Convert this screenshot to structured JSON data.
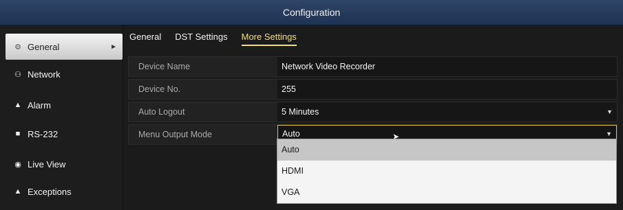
{
  "window": {
    "title": "Configuration"
  },
  "sidebar": {
    "items": [
      {
        "label": "General",
        "icon": "gear-icon",
        "active": true
      },
      {
        "label": "Network",
        "icon": "network-icon"
      },
      {
        "label": "Alarm",
        "icon": "bell-icon"
      },
      {
        "label": "RS-232",
        "icon": "plug-icon"
      },
      {
        "label": "Live View",
        "icon": "eye-icon"
      },
      {
        "label": "Exceptions",
        "icon": "warning-icon"
      }
    ]
  },
  "tabs": [
    {
      "label": "General"
    },
    {
      "label": "DST Settings"
    },
    {
      "label": "More Settings",
      "active": true
    }
  ],
  "settings": [
    {
      "label": "Device Name",
      "value": "Network Video Recorder"
    },
    {
      "label": "Device No.",
      "value": "255"
    },
    {
      "label": "Auto Logout",
      "value": "5 Minutes"
    },
    {
      "label": "Menu Output Mode",
      "value": "Auto"
    }
  ],
  "dropdown": {
    "options": [
      "Auto",
      "HDMI",
      "VGA"
    ],
    "highlighted": "Auto"
  },
  "colors": {
    "titlebar": "#2f4567",
    "accent": "#f2e070",
    "focus_border": "#d9c94a"
  }
}
